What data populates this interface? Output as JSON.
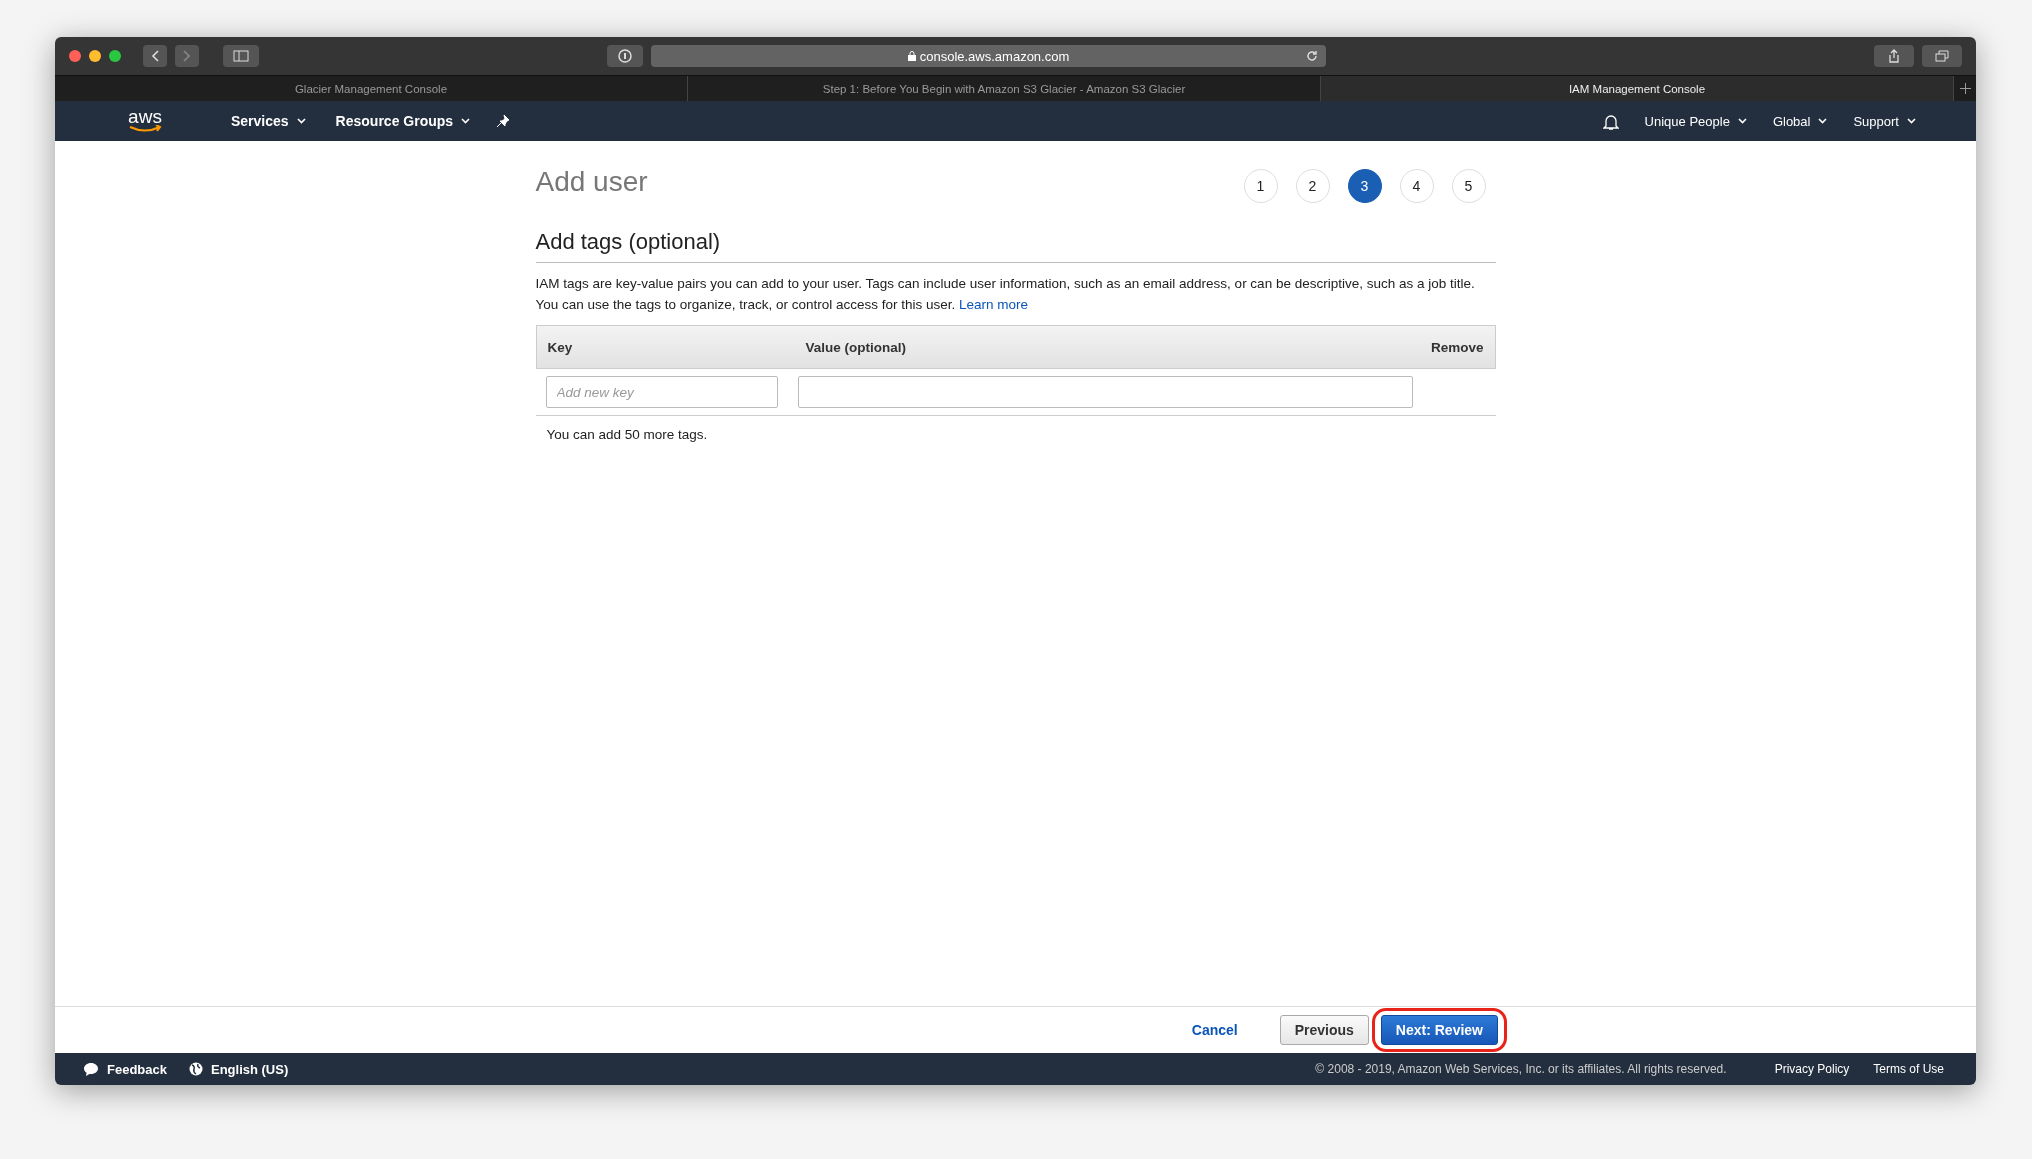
{
  "browser": {
    "url": "console.aws.amazon.com",
    "tabs": [
      {
        "title": "Glacier Management Console",
        "selected": false
      },
      {
        "title": "Step 1: Before You Begin with Amazon S3 Glacier - Amazon S3 Glacier",
        "selected": false
      },
      {
        "title": "IAM Management Console",
        "selected": true
      }
    ]
  },
  "nav": {
    "logo": "aws",
    "left": [
      "Services",
      "Resource Groups"
    ],
    "right": [
      "Unique People",
      "Global",
      "Support"
    ]
  },
  "page": {
    "title": "Add user",
    "steps": [
      {
        "label": "1",
        "selected": false
      },
      {
        "label": "2",
        "selected": false
      },
      {
        "label": "3",
        "selected": true
      },
      {
        "label": "4",
        "selected": false
      },
      {
        "label": "5",
        "selected": false
      }
    ],
    "section_title": "Add tags (optional)",
    "description": "IAM tags are key-value pairs you can add to your user. Tags can include user information, such as an email address, or can be descriptive, such as a job title. You can use the tags to organize, track, or control access for this user.",
    "learn_more": "Learn more",
    "table": {
      "columns": [
        "Key",
        "Value (optional)",
        "Remove"
      ],
      "key_placeholder": "Add new key"
    },
    "hint": "You can add 50 more tags."
  },
  "actions": [
    {
      "label": "Cancel",
      "kind": "link",
      "highlighted": false
    },
    {
      "label": "Previous",
      "kind": "secondary",
      "highlighted": false
    },
    {
      "label": "Next: Review",
      "kind": "primary",
      "highlighted": true
    }
  ],
  "footer": {
    "feedback": "Feedback",
    "language": "English (US)",
    "copyright": "© 2008 - 2019, Amazon Web Services, Inc. or its affiliates. All rights reserved.",
    "links": [
      "Privacy Policy",
      "Terms of Use"
    ]
  }
}
